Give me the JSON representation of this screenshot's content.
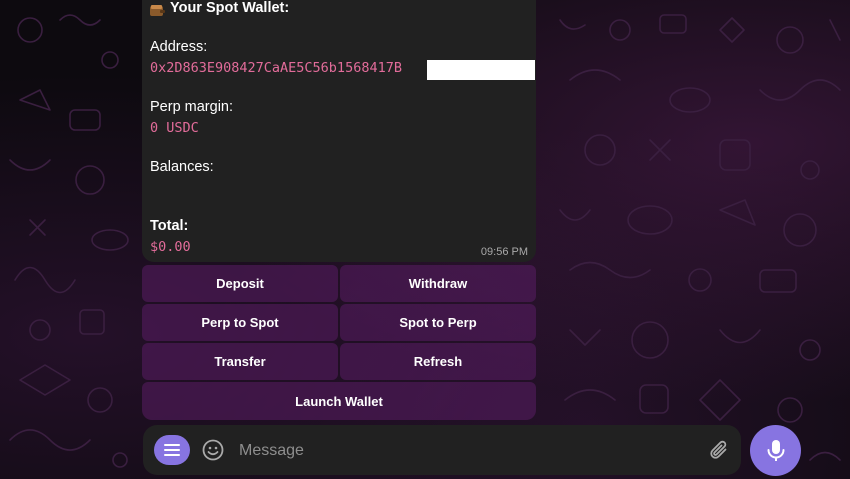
{
  "message": {
    "title": "Your Spot Wallet:",
    "title_icon": "wallet-icon",
    "address_label": "Address:",
    "address_value": "0x2D863E908427CaAE5C56b1568417B",
    "perp_margin_label": "Perp margin:",
    "perp_margin_value": "0 USDC",
    "balances_label": "Balances:",
    "total_label": "Total:",
    "total_value": "$0.00",
    "time": "09:56 PM"
  },
  "keyboard": {
    "buttons": [
      {
        "label": "Deposit"
      },
      {
        "label": "Withdraw"
      },
      {
        "label": "Perp to Spot"
      },
      {
        "label": "Spot to Perp"
      },
      {
        "label": "Transfer"
      },
      {
        "label": "Refresh"
      },
      {
        "label": "Launch Wallet"
      }
    ]
  },
  "composer": {
    "placeholder": "Message",
    "menu_icon": "menu-icon",
    "emoji_icon": "smile-icon",
    "attach_icon": "paperclip-icon",
    "mic_icon": "microphone-icon"
  },
  "colors": {
    "accent": "#8774e1",
    "bubble": "#212121",
    "mono_text": "#e26c9a",
    "keyboard_button": "#5a1e64"
  }
}
